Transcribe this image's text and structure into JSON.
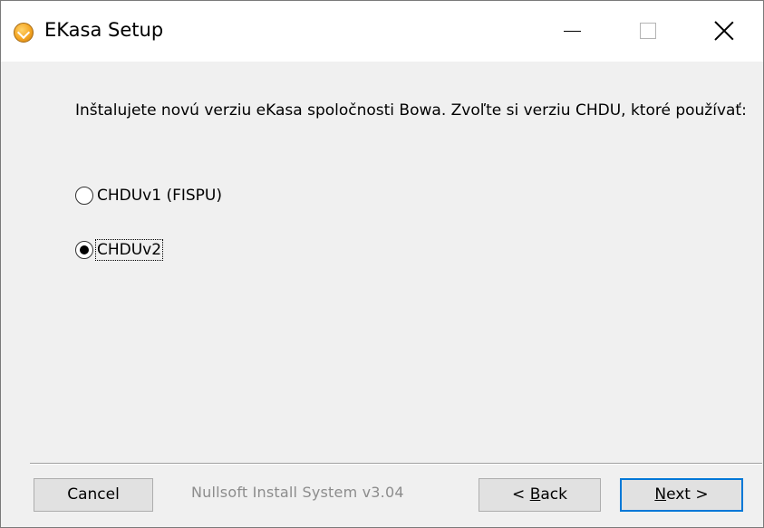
{
  "window": {
    "title": "EKasa Setup",
    "controls": {
      "minimize_icon": "minimize-icon",
      "maximize_icon": "maximize-icon",
      "close_icon": "close-icon"
    }
  },
  "content": {
    "intro_text": "Inštalujete novú verziu eKasa spoločnosti Bowa. Zvoľte si verziu CHDU, ktoré používať:",
    "options": [
      {
        "label": "CHDUv1 (FISPU)",
        "selected": false
      },
      {
        "label": "CHDUv2",
        "selected": true
      }
    ]
  },
  "footer": {
    "branding": "Nullsoft Install System v3.04",
    "cancel_label": "Cancel",
    "back_prefix": "< ",
    "back_access_key": "B",
    "back_rest": "ack",
    "next_access_key": "N",
    "next_rest": "ext >"
  },
  "colors": {
    "window_bg": "#f0f0f0",
    "titlebar_bg": "#ffffff",
    "default_button_border": "#0078d7",
    "branding_text": "#8c8c8c"
  }
}
